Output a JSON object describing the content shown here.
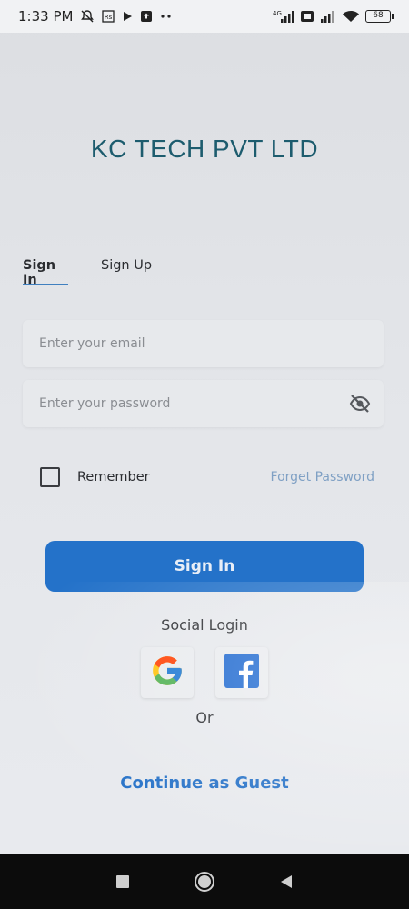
{
  "status_bar": {
    "time": "1:33 PM",
    "network": "4G",
    "battery": "68",
    "icons": [
      "mute-icon",
      "data-saver-icon",
      "play-icon",
      "upload-icon",
      "more-dots-icon",
      "signal-icon",
      "volte-icon",
      "signal-icon",
      "wifi-icon",
      "battery-icon"
    ]
  },
  "brand": {
    "title": "KC TECH PVT LTD"
  },
  "tabs": [
    {
      "label": "Sign In",
      "active": true
    },
    {
      "label": "Sign Up",
      "active": false
    }
  ],
  "form": {
    "email_placeholder": "Enter your email",
    "email_value": "",
    "password_placeholder": "Enter your password",
    "password_value": "",
    "password_toggle_icon": "eye-off-icon",
    "remember_label": "Remember",
    "remember_checked": false,
    "forgot_label": "Forget Password",
    "submit_label": "Sign In"
  },
  "social": {
    "label": "Social Login",
    "providers": [
      "google-icon",
      "facebook-icon"
    ],
    "or_label": "Or",
    "guest_label": "Continue as Guest"
  },
  "nav_bar": {
    "icons": [
      "recents-square-icon",
      "home-circle-icon",
      "back-triangle-icon"
    ]
  },
  "colors": {
    "accent": "#2472c9",
    "title": "#1d5c6e",
    "link": "#7fa0c4",
    "guest": "#2873c8"
  }
}
